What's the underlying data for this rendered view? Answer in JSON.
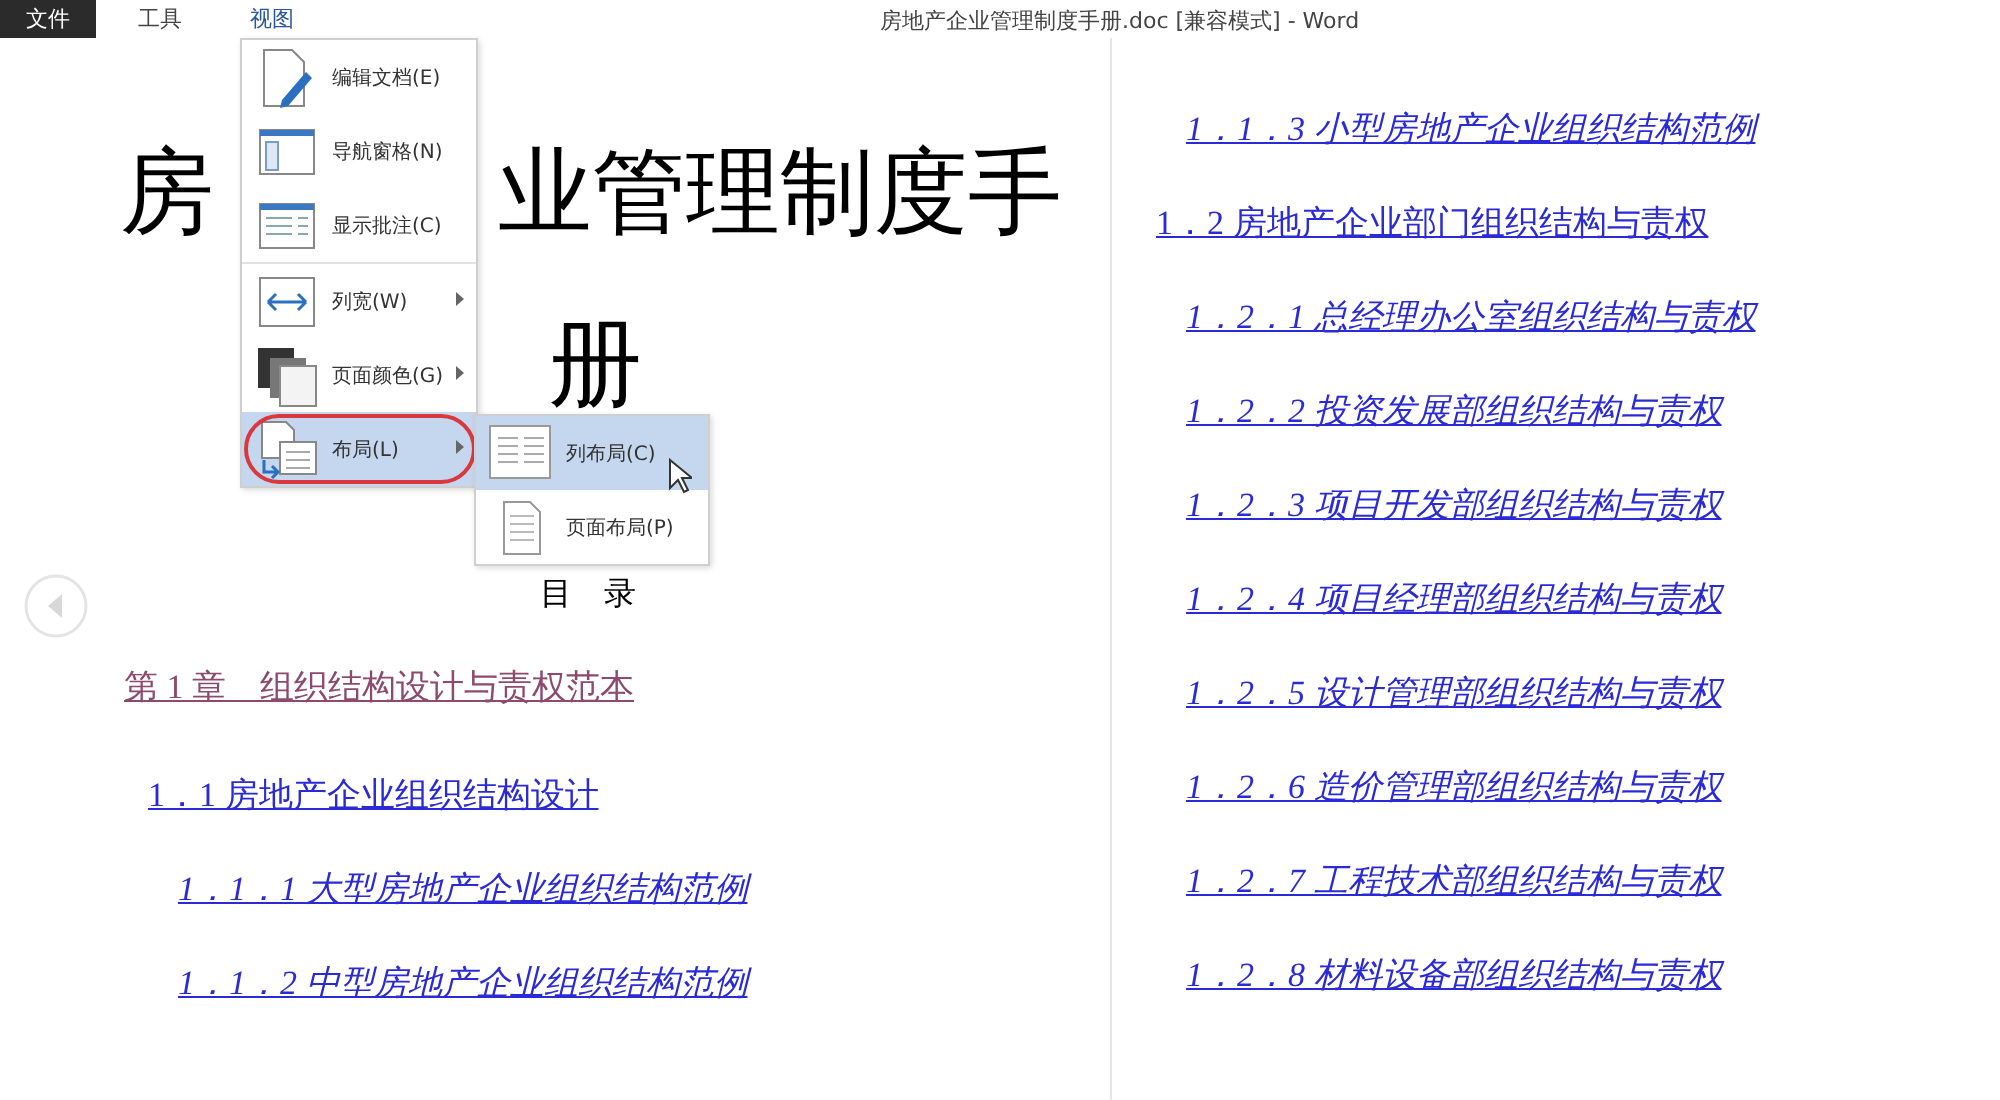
{
  "menubar": {
    "tabs": [
      {
        "label": "文件",
        "kind": "file",
        "selected": false
      },
      {
        "label": "工具",
        "kind": "tab",
        "selected": false
      },
      {
        "label": "视图",
        "kind": "tab",
        "selected": true
      }
    ]
  },
  "window": {
    "title": "房地产企业管理制度手册.doc [兼容模式] - Word"
  },
  "view_menu": {
    "items": [
      {
        "label": "编辑文档(E)",
        "selected": false
      },
      {
        "label": "导航窗格(N)",
        "selected": false
      },
      {
        "label": "显示批注(C)",
        "selected": false
      },
      {
        "label": "列宽(W)",
        "selected": false,
        "has_submenu": true
      },
      {
        "label": "页面颜色(G)",
        "selected": false,
        "has_submenu": true
      },
      {
        "label": "布局(L)",
        "selected": true,
        "has_submenu": true,
        "circled": true,
        "submenu": [
          {
            "label": "列布局(C)",
            "selected": true
          },
          {
            "label": "页面布局(P)",
            "selected": false
          }
        ]
      }
    ]
  },
  "document": {
    "title_fragments": [
      "房",
      "业管理制度手",
      "册"
    ],
    "toc_heading": "目　录",
    "left_column": [
      {
        "kind": "chapter",
        "text": "第 1 章　组织结构设计与责权范本"
      },
      {
        "kind": "section",
        "text": "1．1  房地产企业组织结构设计"
      },
      {
        "kind": "subsection",
        "text": "1．1．1  大型房地产企业组织结构范例"
      },
      {
        "kind": "subsection",
        "text": "1．1．2  中型房地产企业组织结构范例"
      }
    ],
    "right_column": [
      {
        "kind": "subsection",
        "text": "1．1．3  小型房地产企业组织结构范例"
      },
      {
        "kind": "section",
        "text": "1．2  房地产企业部门组织结构与责权"
      },
      {
        "kind": "subsection",
        "text": "1．2．1  总经理办公室组织结构与责权"
      },
      {
        "kind": "subsection",
        "text": "1．2．2  投资发展部组织结构与责权"
      },
      {
        "kind": "subsection",
        "text": "1．2．3  项目开发部组织结构与责权"
      },
      {
        "kind": "subsection",
        "text": "1．2．4  项目经理部组织结构与责权"
      },
      {
        "kind": "subsection",
        "text": "1．2．5  设计管理部组织结构与责权"
      },
      {
        "kind": "subsection",
        "text": "1．2．6  造价管理部组织结构与责权"
      },
      {
        "kind": "subsection",
        "text": "1．2．7  工程技术部组织结构与责权"
      },
      {
        "kind": "subsection",
        "text": "1．2．8  材料设备部组织结构与责权"
      }
    ]
  }
}
